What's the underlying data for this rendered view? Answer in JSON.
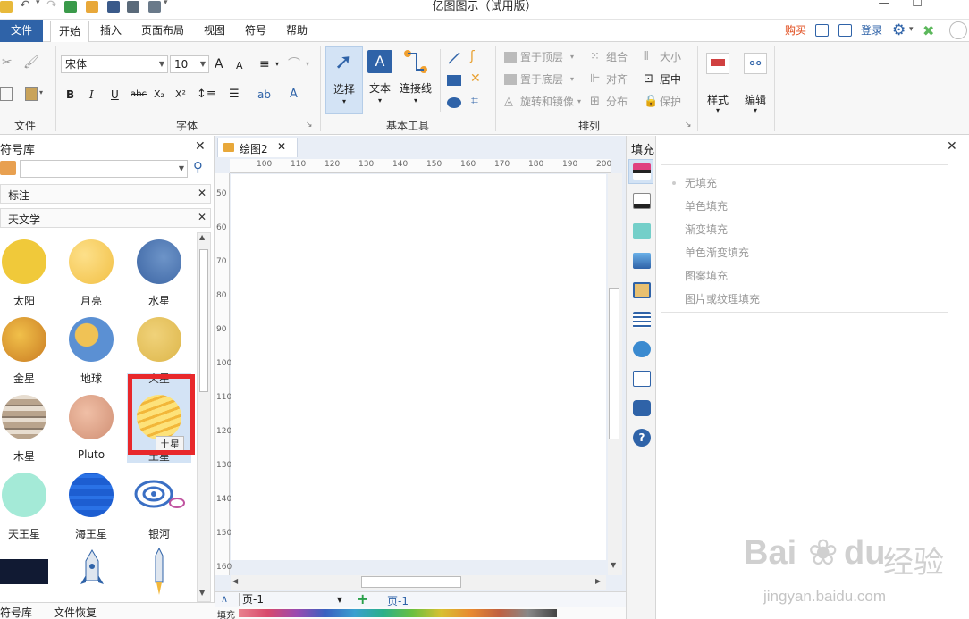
{
  "window": {
    "title": "亿图图示（试用版）",
    "min_glyph": "—",
    "max_glyph": "☐"
  },
  "menu": {
    "file": "文件",
    "tabs": [
      "开始",
      "插入",
      "页面布局",
      "视图",
      "符号",
      "帮助"
    ],
    "buy": "购买",
    "login": "登录"
  },
  "ribbon": {
    "font_name": "宋体",
    "font_size": "10",
    "bold": "B",
    "italic": "I",
    "underline": "U",
    "strike": "abc",
    "sub": "X₂",
    "sup": "X²",
    "grow": "A",
    "shrink": "A",
    "select": "选择",
    "text": "文本",
    "connector": "连接线",
    "bring_front": "置于顶层",
    "send_back": "置于底层",
    "rotate": "旋转和镜像",
    "group": "组合",
    "align": "对齐",
    "distribute": "分布",
    "size": "大小",
    "center": "居中",
    "protect": "保护",
    "style": "样式",
    "edit": "编辑",
    "groups": {
      "file": "文件",
      "font": "字体",
      "basic_tools": "基本工具",
      "arrange": "排列"
    }
  },
  "symbol_library": {
    "title": "符号库",
    "categories": [
      "标注",
      "天文学"
    ],
    "shapes": [
      {
        "label": "太阳",
        "color": "#f0c93a"
      },
      {
        "label": "月亮",
        "color": "#f7cf5e"
      },
      {
        "label": "水星",
        "color": "#3f6fae"
      },
      {
        "label": "金星",
        "color": "#e6b23a"
      },
      {
        "label": "地球",
        "color": "#5b90d3"
      },
      {
        "label": "火星",
        "color": "#e8c661"
      },
      {
        "label": "木星",
        "color": "#c9b8a3"
      },
      {
        "label": "Pluto",
        "color": "#e0a58a"
      },
      {
        "label": "土星",
        "color": "#f7d25a"
      },
      {
        "label": "天王星",
        "color": "#a4ead7"
      },
      {
        "label": "海王星",
        "color": "#1d5ed1"
      },
      {
        "label": "银河",
        "color": "#3a6fc4"
      }
    ],
    "tooltip": "土星",
    "bottom_tabs": [
      "符号库",
      "文件恢复"
    ]
  },
  "canvas": {
    "tab": "绘图2",
    "ruler_h": [
      "100",
      "110",
      "120",
      "130",
      "140",
      "150",
      "160",
      "170",
      "180",
      "190",
      "200"
    ],
    "ruler_v": [
      "50",
      "60",
      "70",
      "80",
      "90",
      "100",
      "110",
      "120",
      "130",
      "140",
      "150",
      "160"
    ],
    "page_select": "页-1",
    "page_tab": "页-1",
    "fill_label": "填充"
  },
  "fill_panel": {
    "title": "填充",
    "options": [
      "无填充",
      "单色填充",
      "渐变填充",
      "单色渐变填充",
      "图案填充",
      "图片或纹理填充"
    ]
  },
  "watermark": {
    "line1": "Bai",
    "line2": "经验",
    "line3": "du",
    "url": "jingyan.baidu.com"
  },
  "colors": {
    "accent": "#2f63a8",
    "highlight": "#e8282b",
    "selected_bg": "#d3e3f5"
  }
}
